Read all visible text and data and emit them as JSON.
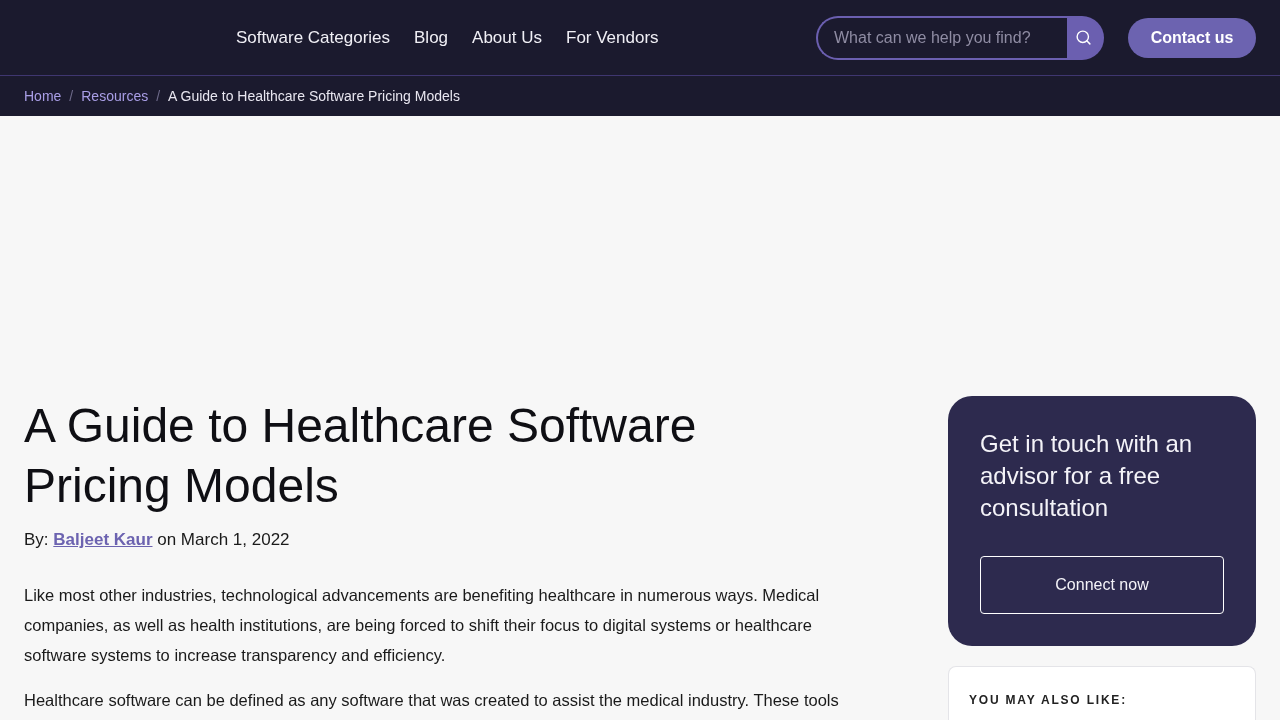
{
  "header": {
    "nav": [
      {
        "label": "Software Categories"
      },
      {
        "label": "Blog"
      },
      {
        "label": "About Us"
      },
      {
        "label": "For Vendors"
      }
    ],
    "search": {
      "placeholder": "What can we help you find?"
    },
    "contact_button": "Contact us"
  },
  "breadcrumb": {
    "separator": "/",
    "items": [
      {
        "label": "Home",
        "current": false
      },
      {
        "label": "Resources",
        "current": false
      },
      {
        "label": "A Guide to Healthcare Software Pricing Models",
        "current": true
      }
    ]
  },
  "article": {
    "title": "A Guide to Healthcare Software Pricing Models",
    "byline": {
      "prefix": "By:",
      "author": "Baljeet Kaur",
      "suffix": "on March 1, 2022"
    },
    "paragraphs": [
      "Like most other industries, technological advancements are benefiting healthcare in numerous ways. Medical companies, as well as health institutions, are being forced to shift their focus to digital systems or healthcare software systems to increase transparency and efficiency.",
      "Healthcare software can be defined as any software that was created to assist the medical industry. These tools"
    ]
  },
  "sidebar": {
    "cta": {
      "heading": "Get in touch with an advisor for a free consultation",
      "button": "Connect now"
    },
    "related": {
      "heading": "YOU MAY ALSO LIKE:"
    }
  }
}
